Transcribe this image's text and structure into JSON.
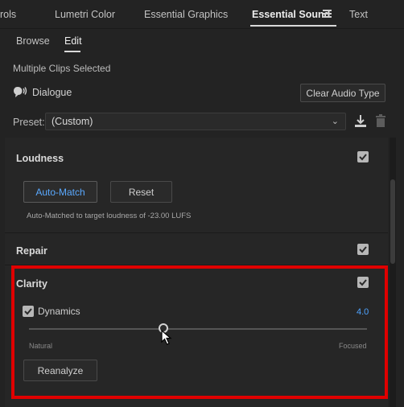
{
  "tabs": {
    "items": [
      {
        "label": "rols"
      },
      {
        "label": "Lumetri Color"
      },
      {
        "label": "Essential Graphics"
      },
      {
        "label": "Essential Sound"
      },
      {
        "label": "Text"
      }
    ],
    "active_index": 3
  },
  "subtabs": {
    "browse": "Browse",
    "edit": "Edit",
    "active": "Edit"
  },
  "selection_status": "Multiple Clips Selected",
  "clip_type": {
    "icon": "speech-bubble-icon",
    "label": "Dialogue",
    "clear_button": "Clear Audio Type"
  },
  "preset": {
    "label": "Preset:",
    "value": "(Custom)",
    "icons": [
      "download-icon",
      "trash-icon"
    ]
  },
  "loudness": {
    "title": "Loudness",
    "enabled": true,
    "auto_match_button": "Auto-Match",
    "reset_button": "Reset",
    "status": "Auto-Matched to target loudness of -23.00 LUFS"
  },
  "repair": {
    "title": "Repair",
    "enabled": true
  },
  "clarity": {
    "title": "Clarity",
    "enabled": true,
    "dynamics": {
      "label": "Dynamics",
      "enabled": true,
      "value": "4.0",
      "slider_fraction": 0.4,
      "min_label": "Natural",
      "max_label": "Focused"
    },
    "reanalyze_button": "Reanalyze"
  },
  "colors": {
    "accent": "#4ea3ff",
    "highlight_frame": "#e00000"
  }
}
